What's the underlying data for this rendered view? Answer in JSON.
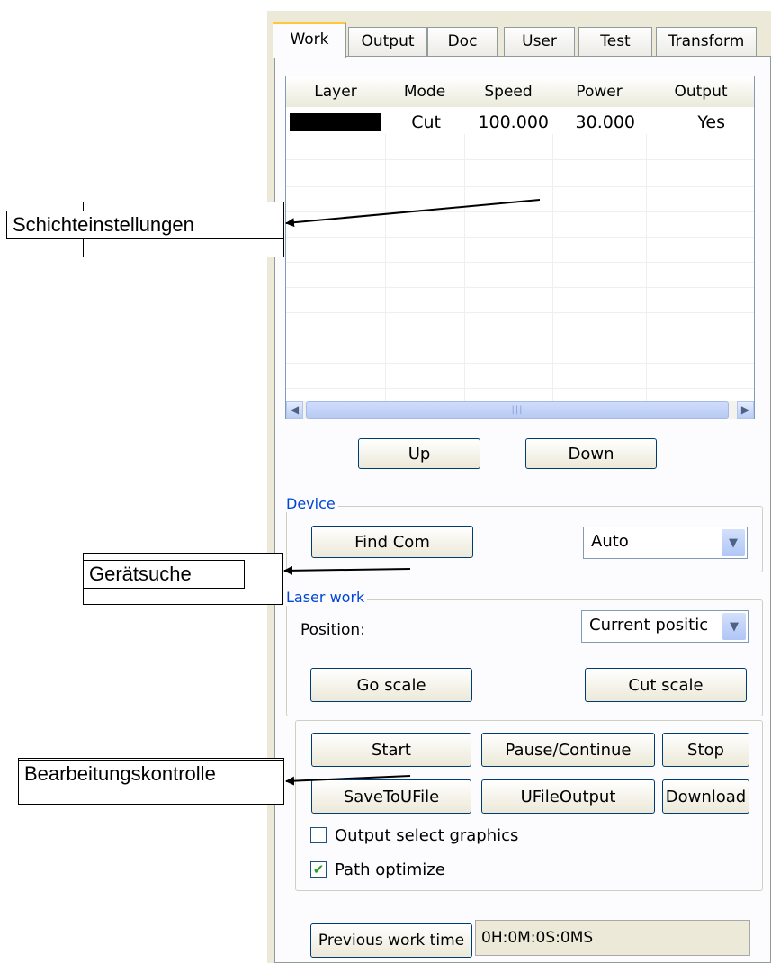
{
  "tabs": [
    {
      "label": "Work",
      "active": true
    },
    {
      "label": "Output",
      "active": false
    },
    {
      "label": "Doc",
      "active": false
    },
    {
      "label": "User",
      "active": false
    },
    {
      "label": "Test",
      "active": false
    },
    {
      "label": "Transform",
      "active": false
    }
  ],
  "layer_table": {
    "columns": [
      "Layer",
      "Mode",
      "Speed",
      "Power",
      "Output"
    ],
    "rows": [
      {
        "layer_color": "#000000",
        "mode": "Cut",
        "speed": "100.000",
        "power": "30.000",
        "output": "Yes"
      }
    ]
  },
  "layer_buttons": {
    "up": "Up",
    "down": "Down"
  },
  "device": {
    "legend": "Device",
    "find_com": "Find Com",
    "port_value": "Auto"
  },
  "laser_work": {
    "legend": "Laser work",
    "position_label": "Position:",
    "position_value": "Current positic",
    "go_scale": "Go scale",
    "cut_scale": "Cut scale"
  },
  "controls": {
    "start": "Start",
    "pause": "Pause/Continue",
    "stop": "Stop",
    "save_ufile": "SaveToUFile",
    "ufile_output": "UFileOutput",
    "download": "Download",
    "output_select_graphics": {
      "label": "Output select graphics",
      "checked": false
    },
    "path_optimize": {
      "label": "Path optimize",
      "checked": true
    }
  },
  "work_time": {
    "button": "Previous work time",
    "value": "0H:0M:0S:0MS"
  },
  "callouts": {
    "layer_settings": "Schichteinstellungen",
    "device_search": "Gerätsuche",
    "process_control": "Bearbeitungskontrolle"
  },
  "colors": {
    "arrow": "#000000",
    "accent_tab": "#ffc83c",
    "group_legend": "#0046d5"
  }
}
